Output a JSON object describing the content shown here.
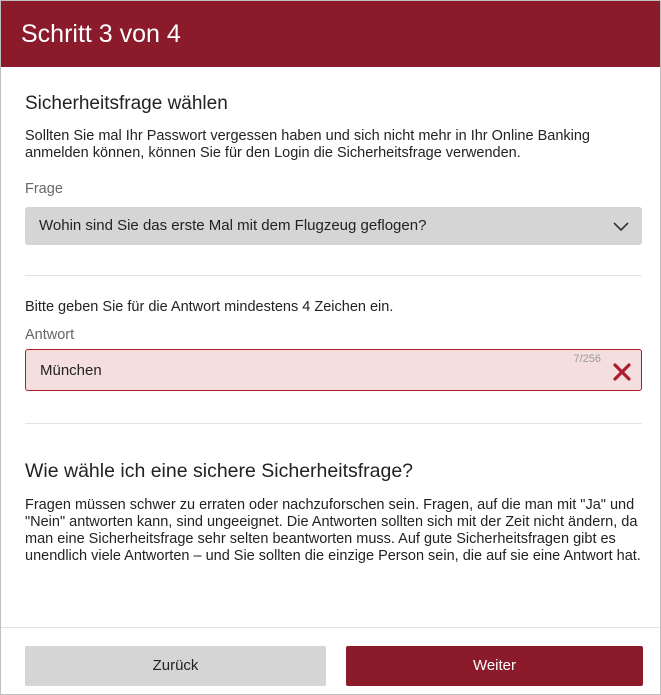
{
  "header": {
    "title": "Schritt 3 von 4"
  },
  "security_question": {
    "section_title": "Sicherheitsfrage wählen",
    "intro": "Sollten Sie mal Ihr Passwort vergessen haben und sich nicht mehr in Ihr Online Banking anmelden können, können Sie für den Login die Sicherheitsfrage verwenden.",
    "question_label": "Frage",
    "question_value": "Wohin sind Sie das erste Mal mit dem Flugzeug geflogen?"
  },
  "answer": {
    "hint": "Bitte geben Sie für die Antwort mindestens 4 Zeichen ein.",
    "label": "Antwort",
    "value": "München",
    "counter": "7/256"
  },
  "help": {
    "title": "Wie wähle ich eine sichere Sicherheitsfrage?",
    "text": "Fragen müssen schwer zu erraten oder nachzuforschen sein. Fragen, auf die man mit \"Ja\" und \"Nein\" antworten kann, sind ungeeignet. Die Antworten sollten sich mit der Zeit nicht ändern, da man eine Sicherheitsfrage sehr selten beantworten muss. Auf gute Sicherheitsfragen gibt es unendlich viele Antworten – und Sie sollten die einzige Person sein, die auf sie eine Antwort hat."
  },
  "buttons": {
    "back": "Zurück",
    "next": "Weiter"
  },
  "colors": {
    "brand": "#8b1a2b",
    "error_border": "#b01c2e",
    "error_bg": "#f4dede"
  },
  "icons": {
    "select": "chevron-down-icon",
    "clear": "close-icon"
  }
}
